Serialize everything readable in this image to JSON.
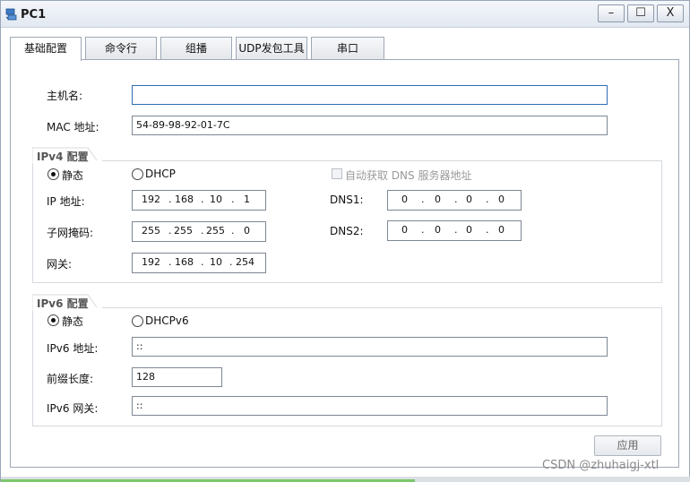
{
  "window": {
    "title": "PC1",
    "app_icon": "pc-icon",
    "controls": {
      "minimize": "–",
      "maximize": "☐",
      "close": "X"
    }
  },
  "tabs": [
    {
      "label": "基础配置",
      "active": true
    },
    {
      "label": "命令行",
      "active": false
    },
    {
      "label": "组播",
      "active": false
    },
    {
      "label": "UDP发包工具",
      "active": false
    },
    {
      "label": "串口",
      "active": false
    }
  ],
  "basic": {
    "hostname_label": "主机名:",
    "hostname_value": "",
    "mac_label": "MAC 地址:",
    "mac_value": "54-89-98-92-01-7C"
  },
  "ipv4": {
    "group_title": "IPv4 配置",
    "static_label": "静态",
    "dhcp_label": "DHCP",
    "selected": "static",
    "auto_dns_label": "自动获取 DNS 服务器地址",
    "auto_dns_checked": false,
    "ip_label": "IP 地址:",
    "ip": [
      "192",
      "168",
      "10",
      "1"
    ],
    "mask_label": "子网掩码:",
    "mask": [
      "255",
      "255",
      "255",
      "0"
    ],
    "gateway_label": "网关:",
    "gateway": [
      "192",
      "168",
      "10",
      "254"
    ],
    "dns1_label": "DNS1:",
    "dns1": [
      "0",
      "0",
      "0",
      "0"
    ],
    "dns2_label": "DNS2:",
    "dns2": [
      "0",
      "0",
      "0",
      "0"
    ]
  },
  "ipv6": {
    "group_title": "IPv6 配置",
    "static_label": "静态",
    "dhcp_label": "DHCPv6",
    "selected": "static",
    "addr_label": "IPv6 地址:",
    "addr_value": "::",
    "prefix_label": "前缀长度:",
    "prefix_value": "128",
    "gateway_label": "IPv6 网关:",
    "gateway_value": "::"
  },
  "apply_label": "应用",
  "watermark": "CSDN @zhuhaigj-xtl",
  "progress_fraction": 0.6,
  "colors": {
    "progress": "#7cc86b",
    "accent": "#2f6db5"
  }
}
